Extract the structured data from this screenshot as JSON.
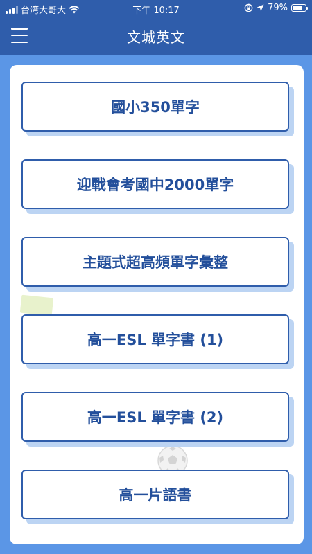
{
  "status_bar": {
    "carrier": "台湾大哥大",
    "time": "下午 10:17",
    "battery": "79%",
    "battery_level": 0.79
  },
  "app_bar": {
    "title": "文城英文",
    "menu_icon": "hamburger-menu-icon"
  },
  "menu": {
    "items": [
      {
        "label": "國小350單字"
      },
      {
        "label": "迎戰會考國中2000單字"
      },
      {
        "label": "主題式超高頻單字彙整"
      },
      {
        "label": "高一ESL 單字書 (1)"
      },
      {
        "label": "高一ESL 單字書 (2)"
      },
      {
        "label": "高一片語書"
      }
    ]
  },
  "colors": {
    "header": "#2f5dab",
    "background": "#5b96e6",
    "button_border": "#2f5dab",
    "button_text": "#234f9b",
    "button_shadow": "#bcd4f3"
  }
}
